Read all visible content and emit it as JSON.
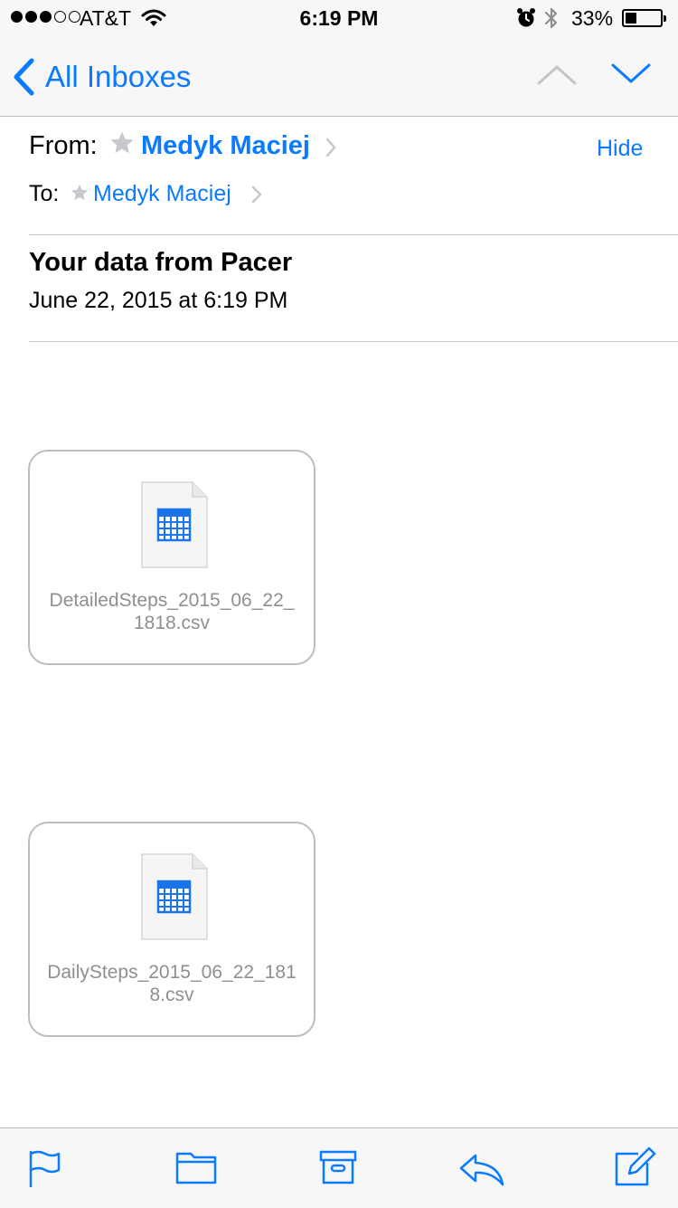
{
  "status_bar": {
    "carrier": "AT&T",
    "time": "6:19 PM",
    "battery_percent": "33%",
    "battery_level": 0.33,
    "signal_bars": 3,
    "signal_total": 5,
    "icons": [
      "wifi-icon",
      "alarm-icon",
      "bluetooth-icon",
      "battery-icon"
    ]
  },
  "nav": {
    "back_label": "All Inboxes",
    "icons": [
      "chevron-left-icon",
      "chevron-up-icon",
      "chevron-down-icon"
    ]
  },
  "header": {
    "from_label": "From:",
    "from_name": "Medyk Maciej",
    "hide_label": "Hide",
    "to_label": "To:",
    "to_name": "Medyk Maciej"
  },
  "message": {
    "subject": "Your data from Pacer",
    "date": "June 22, 2015 at 6:19 PM"
  },
  "attachments": [
    {
      "line1": "DetailedSteps_2015_06_22_",
      "line2": "1818.csv",
      "icon": "spreadsheet-icon"
    },
    {
      "line1": "DailySteps_2015_06_22_181",
      "line2": "8.csv",
      "icon": "spreadsheet-icon"
    }
  ],
  "toolbar": {
    "icons": [
      "flag-icon",
      "folder-icon",
      "archive-icon",
      "reply-icon",
      "compose-icon"
    ]
  },
  "colors": {
    "accent": "#0a7aff",
    "bar_background": "#f7f7f8",
    "secondary_text": "#8e8e93"
  }
}
